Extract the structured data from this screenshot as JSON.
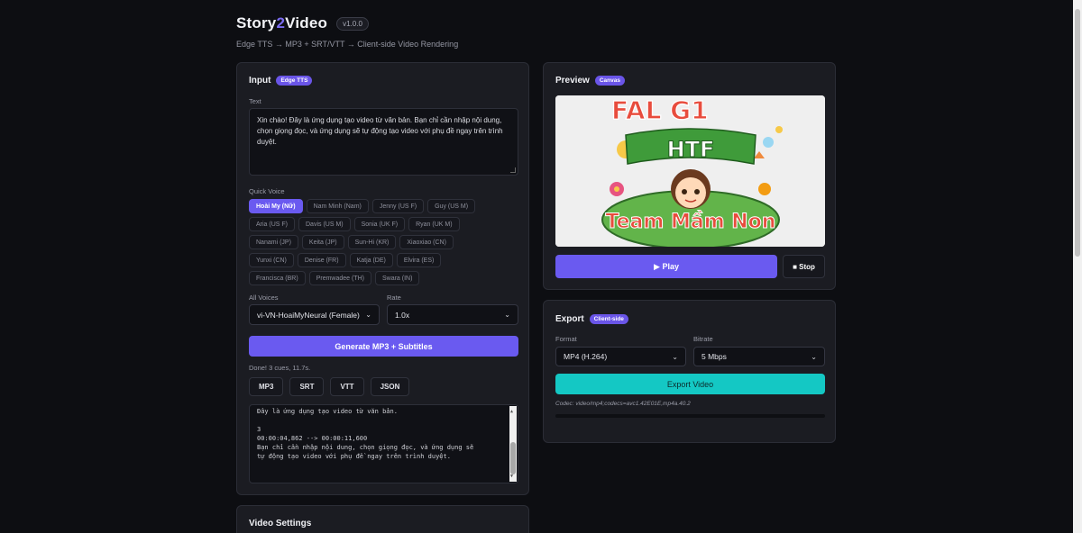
{
  "header": {
    "title_a": "Story",
    "title_b": "2",
    "title_c": "Video",
    "version": "v1.0.0",
    "subtitle": "Edge TTS → MP3 + SRT/VTT → Client-side Video Rendering"
  },
  "input": {
    "title": "Input",
    "badge": "Edge TTS",
    "text_label": "Text",
    "text_value": "Xin chào! Đây là ứng dụng tạo video từ văn bản. Bạn chỉ cần nhập nội dung, chọn giọng đọc, và ứng dụng sẽ tự động tạo video với phụ đề ngay trên trình duyệt.",
    "quick_voice_label": "Quick Voice",
    "quick_voices": [
      [
        "Hoài My (Nữ)",
        "Nam Minh (Nam)",
        "Jenny (US F)",
        "Guy (US M)"
      ],
      [
        "Aria (US F)",
        "Davis (US M)",
        "Sonia (UK F)",
        "Ryan (UK M)"
      ],
      [
        "Nanami (JP)",
        "Keita (JP)",
        "Sun-Hi (KR)",
        "Xiaoxiao (CN)"
      ],
      [
        "Yunxi (CN)",
        "Denise (FR)",
        "Katja (DE)",
        "Elvira (ES)"
      ],
      [
        "Francisca (BR)",
        "Premwadee (TH)",
        "Swara (IN)"
      ]
    ],
    "active_voice": "Hoài My (Nữ)",
    "all_voices_label": "All Voices",
    "all_voices_value": "vi-VN-HoaiMyNeural (Female)",
    "rate_label": "Rate",
    "rate_value": "1.0x",
    "generate_label": "Generate MP3 + Subtitles",
    "status": "Done! 3 cues, 11.7s.",
    "downloads": [
      "MP3",
      "SRT",
      "VTT",
      "JSON"
    ],
    "subtitle_lines": [
      "Đây là ứng dụng tạo video từ văn bản.",
      "",
      "3",
      "00:00:04,862 --> 00:00:11,600",
      "Bạn chỉ cần nhập nội dung, chọn giọng đọc, và ứng dụng sẽ",
      "tự động tạo video với phụ đề ngay trên trình duyệt."
    ]
  },
  "video_settings": {
    "title": "Video Settings"
  },
  "preview": {
    "title": "Preview",
    "badge": "Canvas",
    "image_text_top": "FAL G1",
    "image_text_banner": "HTF",
    "image_text_bottom": "Team Mầm Non",
    "play_label": "▶ Play",
    "stop_label": "■ Stop"
  },
  "export": {
    "title": "Export",
    "badge": "Client-side",
    "format_label": "Format",
    "format_value": "MP4 (H.264)",
    "bitrate_label": "Bitrate",
    "bitrate_value": "5 Mbps",
    "export_label": "Export Video",
    "codec": "Codec: video/mp4;codecs=avc1.42E01E,mp4a.40.2"
  },
  "colors": {
    "accent": "#6a5af0",
    "export": "#14c8c4",
    "bg": "#0d0e12",
    "card": "#1b1c22"
  }
}
